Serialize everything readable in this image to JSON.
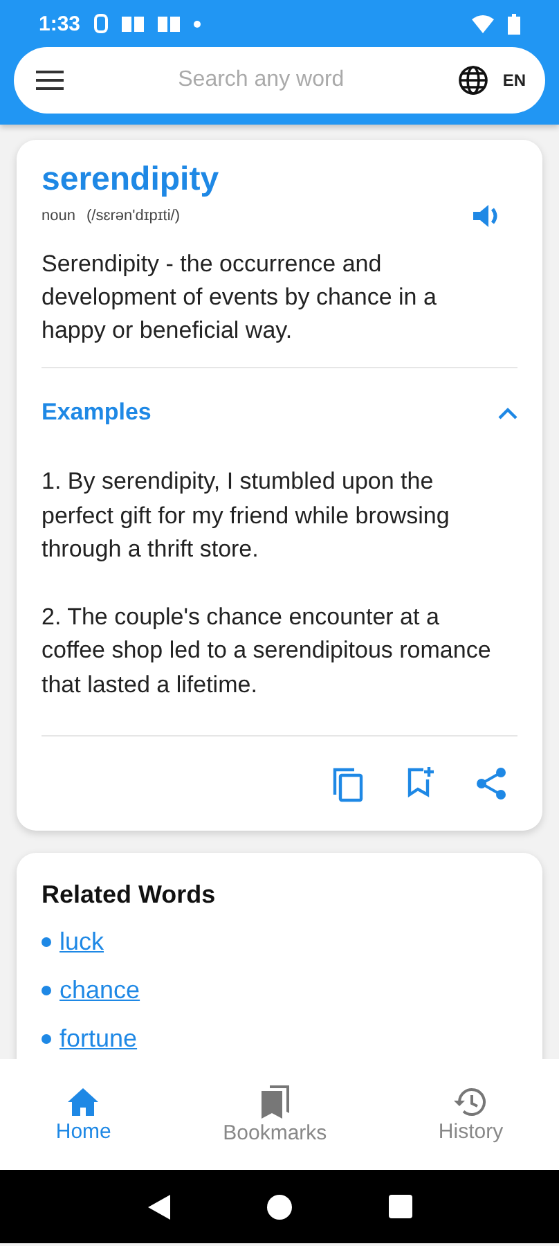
{
  "status_bar": {
    "time": "1:33"
  },
  "search": {
    "placeholder": "Search any word",
    "language": "EN"
  },
  "entry": {
    "word": "serendipity",
    "part_of_speech": "noun",
    "pronunciation": "(/sɛrən'dɪpɪti/)",
    "definition": "Serendipity - the occurrence and development of events by chance in a happy or beneficial way.",
    "examples": {
      "title": "Examples",
      "expanded": true,
      "items": [
        "1. By serendipity, I stumbled upon the perfect gift for my friend while browsing through a thrift store.",
        "2. The couple's chance encounter at a coffee shop led to a serendipitous romance that lasted a lifetime."
      ]
    }
  },
  "related": {
    "title": "Related Words",
    "words": [
      "luck",
      "chance",
      "fortune"
    ]
  },
  "nav_tabs": [
    {
      "label": "Home",
      "selected": true
    },
    {
      "label": "Bookmarks",
      "selected": false
    },
    {
      "label": "History",
      "selected": false
    }
  ]
}
